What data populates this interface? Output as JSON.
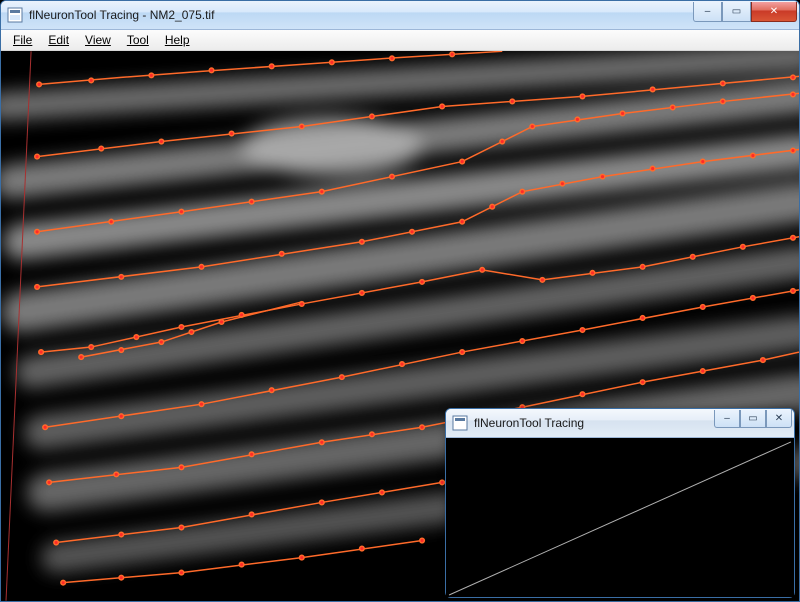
{
  "main_window": {
    "title": "flNeuronTool Tracing - NM2_075.tif",
    "menus": {
      "file": "File",
      "edit": "Edit",
      "view": "View",
      "tool": "Tool",
      "help": "Help"
    },
    "win_controls": {
      "minimize": "–",
      "maximize": "▭",
      "close": "✕"
    }
  },
  "sub_window": {
    "title": "flNeuronTool Tracing",
    "win_controls": {
      "minimize": "–",
      "maximize": "▭",
      "close": "✕"
    }
  },
  "colors": {
    "trace_line": "#ff6a2a",
    "trace_node": "#ff2a2a",
    "axis_line": "#a83030",
    "sub_line": "#b0b0b0"
  }
}
